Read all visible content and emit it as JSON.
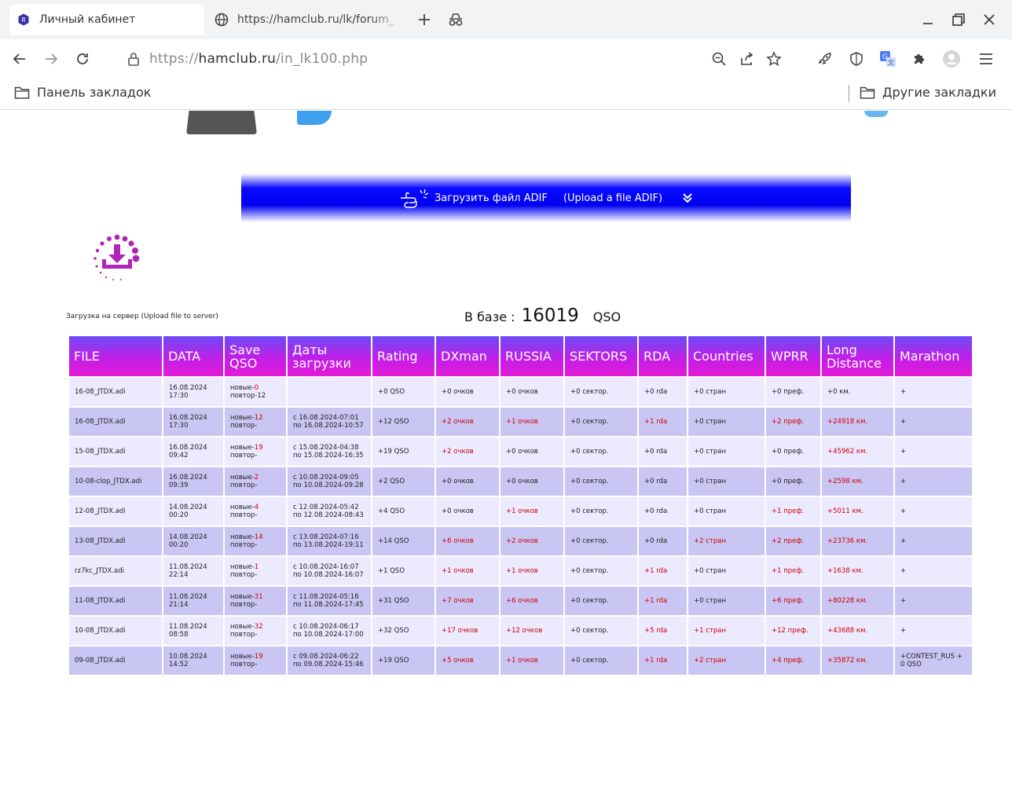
{
  "browser": {
    "active_tab_title": "Личный кабинет",
    "inactive_tab_title": "https://hamclub.ru/lk/forum_",
    "url_prefix": "https://",
    "url_host": "hamclub.ru",
    "url_path": "/in_lk100.php",
    "bookmarks_left": "Панель закладок",
    "bookmarks_right": "Другие закладки"
  },
  "page": {
    "upload_button_ru": "Загрузить файл ADIF",
    "upload_button_en": "(Upload a file ADIF)",
    "server_caption": "Загрузка на сервер (Upload file to server)",
    "count_label": "В базе :",
    "count_value": "16019",
    "count_unit": "QSO"
  },
  "table": {
    "headers": [
      "FILE",
      "DATA",
      "Save QSO",
      "Даты загрузки",
      "Rating",
      "DXman",
      "RUSSIA",
      "SEKTORS",
      "RDA",
      "Countries",
      "WPRR",
      "Long Distance",
      "Marathon"
    ],
    "rows": [
      {
        "file": "16-08_JTDX.adi",
        "data": [
          "16.08.2024",
          "17:30"
        ],
        "save_label": "новые-",
        "save_new": "0",
        "save_rep": "повтор-12",
        "dates": [
          "",
          ""
        ],
        "rating": "+0 QSO",
        "dxman": "+0 очков",
        "russia": "+0 очков",
        "sektors": "+0 сектор.",
        "rda": "+0 rda",
        "countries": "+0 стран",
        "wprr": "+0 преф.",
        "long": "+0 км.",
        "marathon": "+"
      },
      {
        "file": "16-08_JTDX.adi",
        "data": [
          "16.08.2024",
          "17:30"
        ],
        "save_label": "новые-",
        "save_new": "12",
        "save_rep": "повтор-",
        "dates": [
          "с 16.08.2024-07:01",
          "по 16.08.2024-10:57"
        ],
        "rating": "+12 QSO",
        "dxman": "+2 очков",
        "russia": "+1 очков",
        "sektors": "+0 сектор.",
        "rda": "+1 rda",
        "countries": "+0 стран",
        "wprr": "+2 преф.",
        "long": "+24918 км.",
        "marathon": "+"
      },
      {
        "file": "15-08_JTDX.adi",
        "data": [
          "16.08.2024",
          "09:42"
        ],
        "save_label": "новые-",
        "save_new": "19",
        "save_rep": "повтор-",
        "dates": [
          "с 15.08.2024-04:38",
          "по 15.08.2024-16:35"
        ],
        "rating": "+19 QSO",
        "dxman": "+2 очков",
        "russia": "+0 очков",
        "sektors": "+0 сектор.",
        "rda": "+0 rda",
        "countries": "+0 стран",
        "wprr": "+0 преф.",
        "long": "+45962 км.",
        "marathon": "+"
      },
      {
        "file": "10-08-clop_JTDX.adi",
        "data": [
          "16.08.2024",
          "09:39"
        ],
        "save_label": "новые-",
        "save_new": "2",
        "save_rep": "повтор-",
        "dates": [
          "с 10.08.2024-09:05",
          "по 10.08.2024-09:28"
        ],
        "rating": "+2 QSO",
        "dxman": "+0 очков",
        "russia": "+0 очков",
        "sektors": "+0 сектор.",
        "rda": "+0 rda",
        "countries": "+0 стран",
        "wprr": "+0 преф.",
        "long": "+2598 км.",
        "marathon": "+"
      },
      {
        "file": "12-08_JTDX.adi",
        "data": [
          "14.08.2024",
          "00:20"
        ],
        "save_label": "новые-",
        "save_new": "4",
        "save_rep": "повтор-",
        "dates": [
          "с 12.08.2024-05:42",
          "по 12.08.2024-08:43"
        ],
        "rating": "+4 QSO",
        "dxman": "+0 очков",
        "russia": "+1 очков",
        "sektors": "+0 сектор.",
        "rda": "+0 rda",
        "countries": "+0 стран",
        "wprr": "+1 преф.",
        "long": "+5011 км.",
        "marathon": "+"
      },
      {
        "file": "13-08_JTDX.adi",
        "data": [
          "14.08.2024",
          "00:20"
        ],
        "save_label": "новые-",
        "save_new": "14",
        "save_rep": "повтор-",
        "dates": [
          "с 13.08.2024-07:16",
          "по 13.08.2024-19:11"
        ],
        "rating": "+14 QSO",
        "dxman": "+6 очков",
        "russia": "+2 очков",
        "sektors": "+0 сектор.",
        "rda": "+0 rda",
        "countries": "+2 стран",
        "wprr": "+2 преф.",
        "long": "+23736 км.",
        "marathon": "+"
      },
      {
        "file": "rz7kc_JTDX.adi",
        "data": [
          "11.08.2024",
          "22:14"
        ],
        "save_label": "новые-",
        "save_new": "1",
        "save_rep": "повтор-",
        "dates": [
          "с 10.08.2024-16:07",
          "по 10.08.2024-16:07"
        ],
        "rating": "+1 QSO",
        "dxman": "+1 очков",
        "russia": "+1 очков",
        "sektors": "+0 сектор.",
        "rda": "+1 rda",
        "countries": "+0 стран",
        "wprr": "+1 преф.",
        "long": "+1638 км.",
        "marathon": "+"
      },
      {
        "file": "11-08_JTDX.adi",
        "data": [
          "11.08.2024",
          "21:14"
        ],
        "save_label": "новые-",
        "save_new": "31",
        "save_rep": "повтор-",
        "dates": [
          "с 11.08.2024-05:16",
          "по 11.08.2024-17:45"
        ],
        "rating": "+31 QSO",
        "dxman": "+7 очков",
        "russia": "+6 очков",
        "sektors": "+0 сектор.",
        "rda": "+1 rda",
        "countries": "+0 стран",
        "wprr": "+6 преф.",
        "long": "+80228 км.",
        "marathon": "+"
      },
      {
        "file": "10-08_JTDX.adi",
        "data": [
          "11.08.2024",
          "08:58"
        ],
        "save_label": "новые-",
        "save_new": "32",
        "save_rep": "повтор-",
        "dates": [
          "с 10.08.2024-06:17",
          "по 10.08.2024-17:00"
        ],
        "rating": "+32 QSO",
        "dxman": "+17 очков",
        "russia": "+12 очков",
        "sektors": "+0 сектор.",
        "rda": "+5 rda",
        "countries": "+1 стран",
        "wprr": "+12 преф.",
        "long": "+43688 км.",
        "marathon": "+"
      },
      {
        "file": "09-08_JTDX.adi",
        "data": [
          "10.08.2024",
          "14:52"
        ],
        "save_label": "новые-",
        "save_new": "19",
        "save_rep": "повтор-",
        "dates": [
          "с 09.08.2024-06:22",
          "по 09.08.2024-15:46"
        ],
        "rating": "+19 QSO",
        "dxman": "+5 очков",
        "russia": "+1 очков",
        "sektors": "+0 сектор.",
        "rda": "+1 rda",
        "countries": "+2 стран",
        "wprr": "+4 преф.",
        "long": "+35872 км.",
        "marathon": "+CONTEST_RUS + 0 QSO"
      }
    ]
  },
  "colors": {
    "upload_bar_blue": "#0000f0",
    "header_purple": "#c11fe8",
    "row_light": "#eceaff",
    "row_dark": "#c9c6f4",
    "highlight_red": "#d00000"
  }
}
